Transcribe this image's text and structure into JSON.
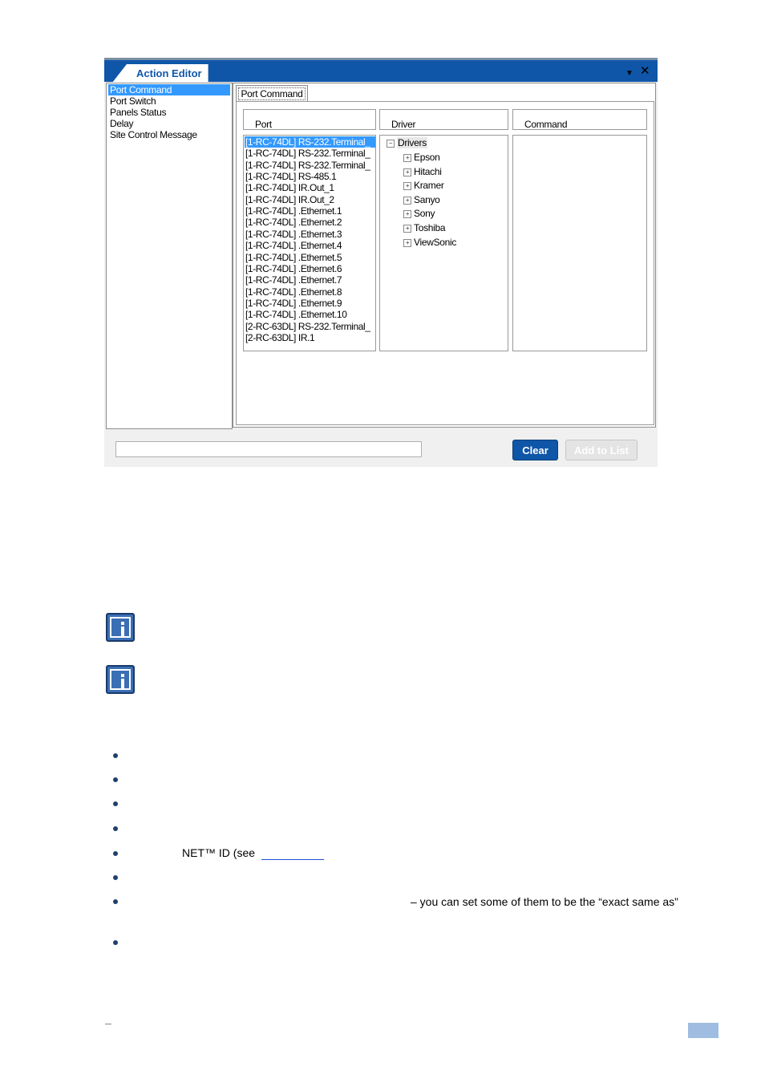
{
  "window": {
    "title": "Action Editor"
  },
  "left_menu": [
    "Port Command",
    "Port Switch",
    "Panels Status",
    "Delay",
    "Site Control Message"
  ],
  "tab": {
    "label": "Port Command"
  },
  "columns": {
    "port": "Port",
    "driver": "Driver",
    "command": "Command"
  },
  "ports": [
    "[1-RC-74DL] RS-232.Terminal_",
    "[1-RC-74DL] RS-232.Terminal_",
    "[1-RC-74DL] RS-232.Terminal_",
    "[1-RC-74DL] RS-485.1",
    "[1-RC-74DL] IR.Out_1",
    "[1-RC-74DL] IR.Out_2",
    "[1-RC-74DL] .Ethernet.1",
    "[1-RC-74DL] .Ethernet.2",
    "[1-RC-74DL] .Ethernet.3",
    "[1-RC-74DL] .Ethernet.4",
    "[1-RC-74DL] .Ethernet.5",
    "[1-RC-74DL] .Ethernet.6",
    "[1-RC-74DL] .Ethernet.7",
    "[1-RC-74DL] .Ethernet.8",
    "[1-RC-74DL] .Ethernet.9",
    "[1-RC-74DL] .Ethernet.10",
    "[2-RC-63DL] RS-232.Terminal_",
    "[2-RC-63DL] IR.1"
  ],
  "drivers": {
    "root": "Drivers",
    "children": [
      "Epson",
      "Hitachi",
      "Kramer",
      "Sanyo",
      "Sony",
      "Toshiba",
      "ViewSonic"
    ]
  },
  "buttons": {
    "clear": "Clear",
    "add": "Add to List"
  },
  "doc": {
    "net_text": "NET™ ID (see",
    "same_as_text": "– you can set some of them to be the “exact same as”"
  },
  "colors": {
    "accent": "#0f56a8",
    "selection": "#3399ff"
  }
}
